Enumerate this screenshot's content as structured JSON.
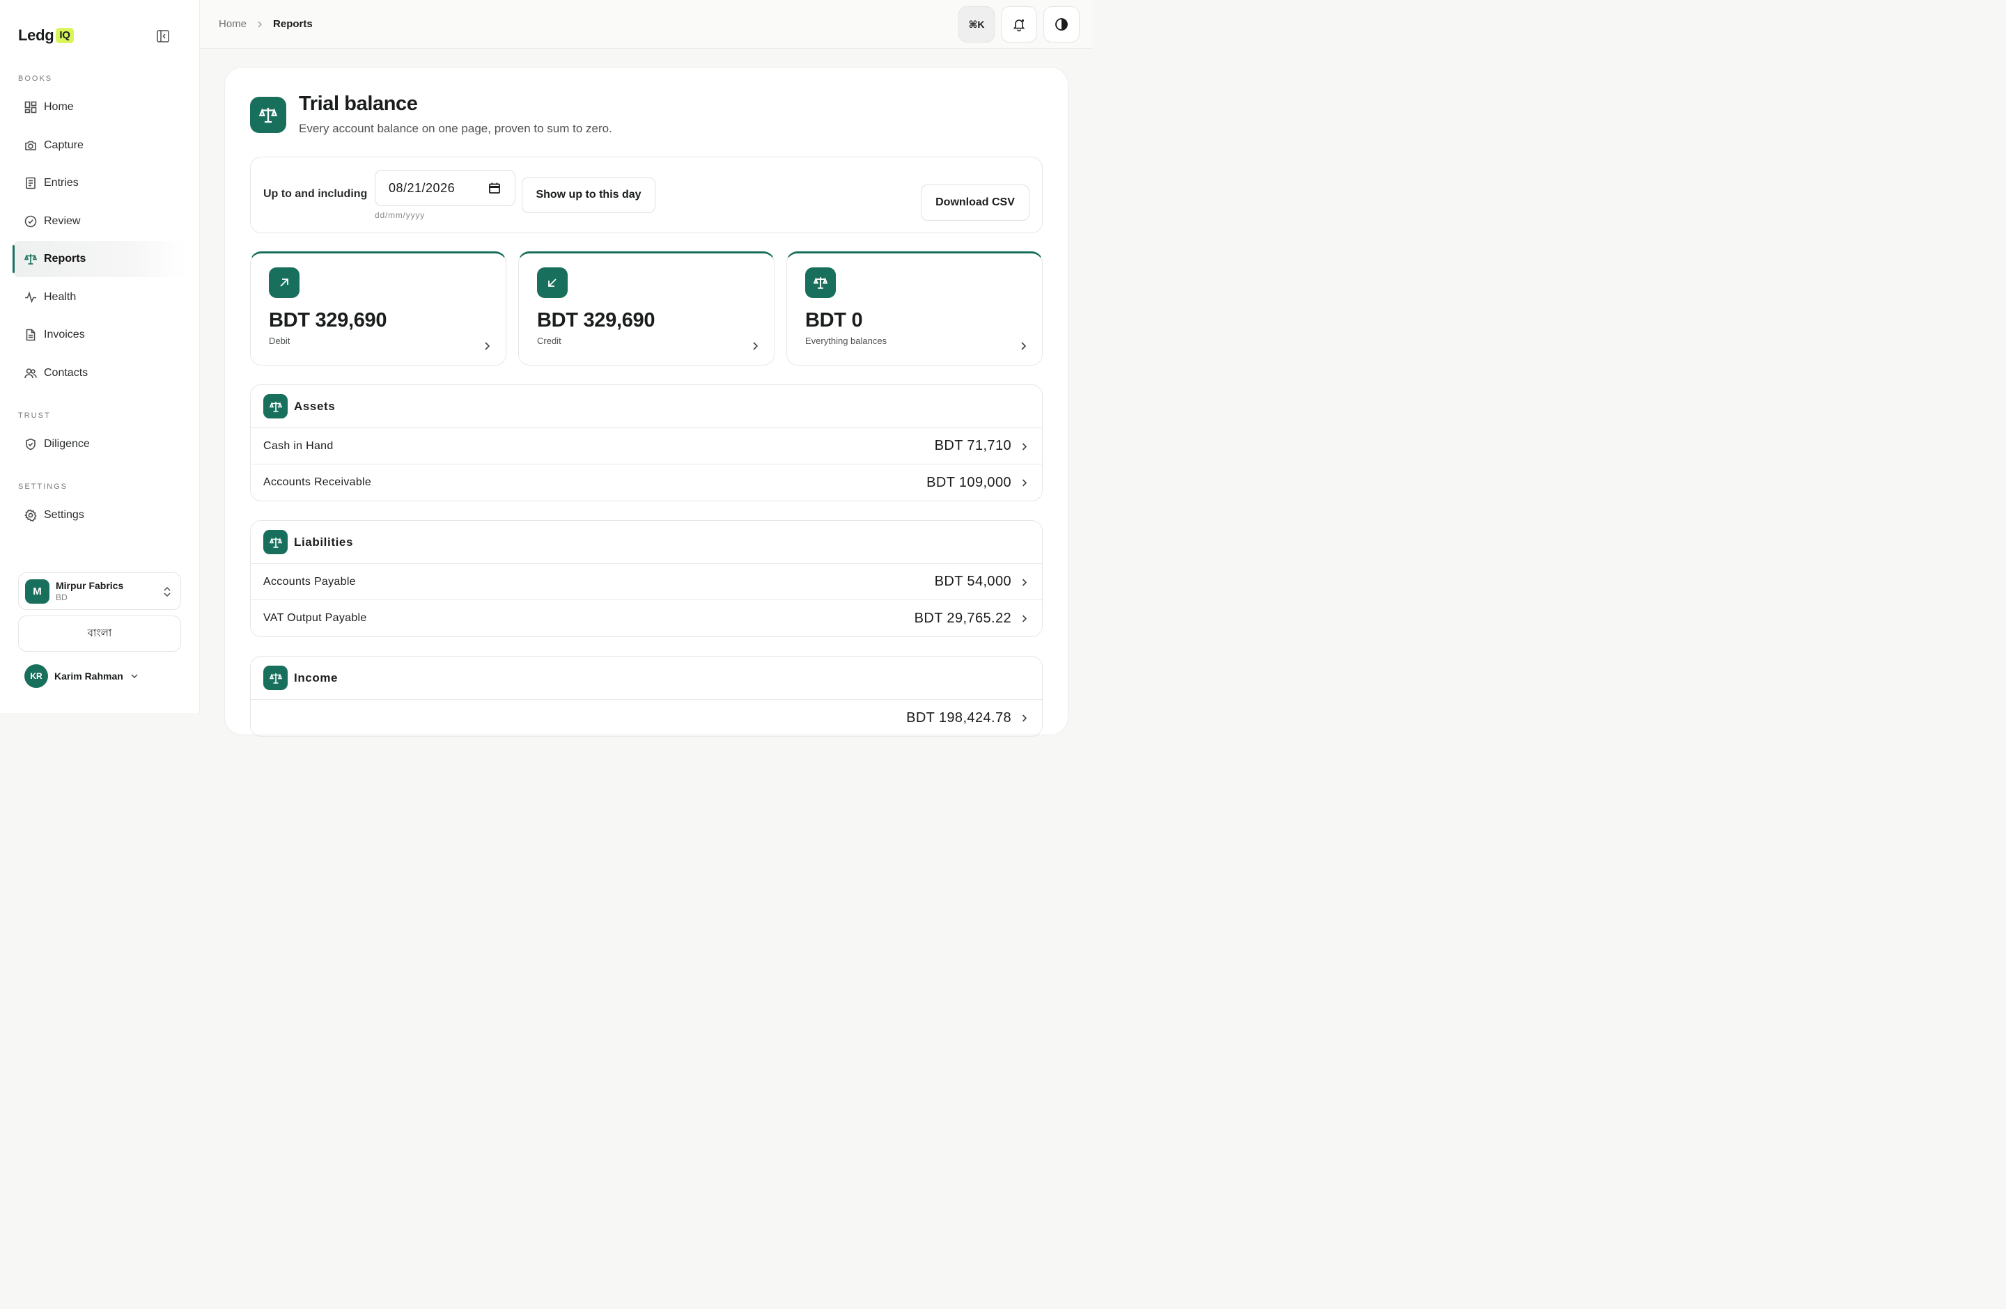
{
  "brand": {
    "name": "Ledg",
    "badge": "IQ"
  },
  "sidebar": {
    "sections": {
      "books": "BOOKS",
      "trust": "TRUST",
      "settings": "SETTINGS"
    },
    "items": [
      {
        "label": "Home",
        "icon": "grid-icon"
      },
      {
        "label": "Capture",
        "icon": "camera-icon"
      },
      {
        "label": "Entries",
        "icon": "ledger-icon"
      },
      {
        "label": "Review",
        "icon": "check-circle-icon"
      },
      {
        "label": "Reports",
        "icon": "scale-icon",
        "active": true
      },
      {
        "label": "Health",
        "icon": "pulse-icon"
      },
      {
        "label": "Invoices",
        "icon": "document-icon"
      },
      {
        "label": "Contacts",
        "icon": "users-icon"
      },
      {
        "label": "Diligence",
        "icon": "shield-check-icon"
      },
      {
        "label": "Settings",
        "icon": "gear-icon"
      }
    ],
    "org": {
      "initial": "M",
      "name": "Mirpur Fabrics",
      "country": "BD"
    },
    "language_button": "বাংলা",
    "user": {
      "initials": "KR",
      "name": "Karim Rahman"
    }
  },
  "topbar": {
    "breadcrumb": {
      "home": "Home",
      "current": "Reports"
    },
    "command_label": "⌘K"
  },
  "page": {
    "title": "Trial balance",
    "subtitle": "Every account balance on one page, proven to sum to zero."
  },
  "filter": {
    "label": "Up to and including",
    "date_value": "08/21/2026",
    "date_hint": "dd/mm/yyyy",
    "show_button": "Show up to this day",
    "csv_button": "Download CSV"
  },
  "stats": [
    {
      "value": "BDT 329,690",
      "label": "Debit",
      "icon": "arrow-up-right-icon"
    },
    {
      "value": "BDT 329,690",
      "label": "Credit",
      "icon": "arrow-down-left-icon"
    },
    {
      "value": "BDT 0",
      "label": "Everything balances",
      "icon": "scale-icon"
    }
  ],
  "groups": [
    {
      "title": "Assets",
      "rows": [
        {
          "name": "Cash in Hand",
          "amount": "BDT 71,710"
        },
        {
          "name": "Accounts Receivable",
          "amount": "BDT 109,000"
        }
      ]
    },
    {
      "title": "Liabilities",
      "rows": [
        {
          "name": "Accounts Payable",
          "amount": "BDT 54,000"
        },
        {
          "name": "VAT Output Payable",
          "amount": "BDT 29,765.22"
        }
      ]
    },
    {
      "title": "Income",
      "rows": [
        {
          "name": "",
          "amount": "BDT 198,424.78"
        }
      ]
    }
  ],
  "colors": {
    "accent": "#186f5c",
    "badge": "#d8f55a"
  }
}
